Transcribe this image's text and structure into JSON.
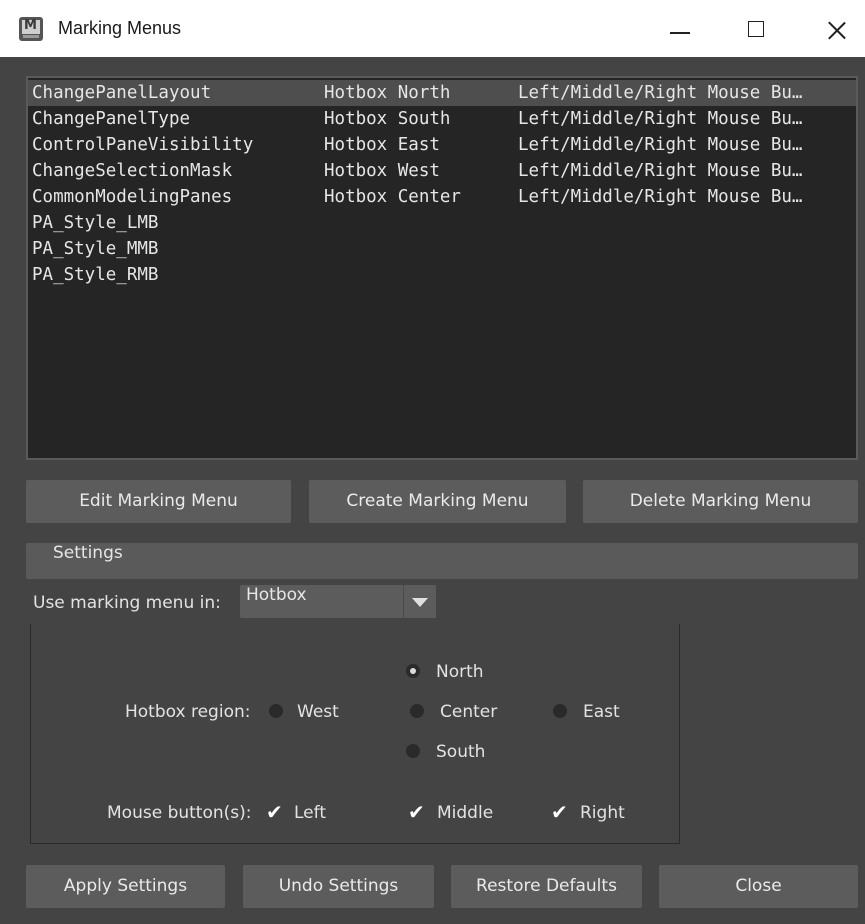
{
  "window": {
    "title": "Marking Menus",
    "icon_letter": "M",
    "controls": [
      "minimize-icon",
      "maximize-icon",
      "close-icon"
    ]
  },
  "menu_list": {
    "rows": [
      {
        "name": "ChangePanelLayout",
        "location": "Hotbox North",
        "button": "Left/Middle/Right Mouse Bu…",
        "selected": true
      },
      {
        "name": "ChangePanelType",
        "location": "Hotbox South",
        "button": "Left/Middle/Right Mouse Bu…"
      },
      {
        "name": "ControlPaneVisibility",
        "location": "Hotbox East",
        "button": "Left/Middle/Right Mouse Bu…"
      },
      {
        "name": "ChangeSelectionMask",
        "location": "Hotbox West",
        "button": "Left/Middle/Right Mouse Bu…"
      },
      {
        "name": "CommonModelingPanes",
        "location": "Hotbox Center",
        "button": "Left/Middle/Right Mouse Bu…"
      },
      {
        "name": "PA_Style_LMB",
        "location": "",
        "button": ""
      },
      {
        "name": "PA_Style_MMB",
        "location": "",
        "button": ""
      },
      {
        "name": "PA_Style_RMB",
        "location": "",
        "button": ""
      }
    ]
  },
  "actions": {
    "edit": "Edit Marking Menu",
    "create": "Create Marking Menu",
    "delete": "Delete Marking Menu"
  },
  "settings": {
    "header": "Settings",
    "use_in_label": "Use marking menu in:",
    "use_in_value": "Hotbox",
    "hotbox_region_label": "Hotbox region:",
    "regions": {
      "north": "North",
      "west": "West",
      "center": "Center",
      "east": "East",
      "south": "South",
      "selected": "North"
    },
    "mouse_buttons_label": "Mouse button(s):",
    "mouse_buttons": {
      "left": "Left",
      "middle": "Middle",
      "right": "Right",
      "left_checked": true,
      "middle_checked": true,
      "right_checked": true
    }
  },
  "footer": {
    "apply": "Apply Settings",
    "undo": "Undo Settings",
    "restore": "Restore Defaults",
    "close": "Close"
  }
}
